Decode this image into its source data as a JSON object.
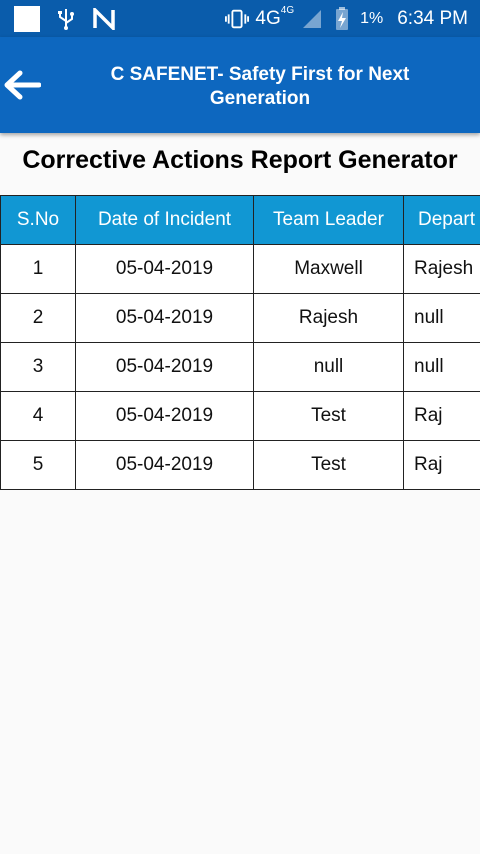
{
  "status_bar": {
    "network": "4G",
    "network_sup": "4G",
    "battery": "1%",
    "time": "6:34 PM"
  },
  "app_bar": {
    "title": "C SAFENET- Safety First for Next\nGeneration"
  },
  "page": {
    "title": "Corrective Actions Report Generator"
  },
  "table": {
    "headers": [
      "S.No",
      "Date of Incident",
      "Team Leader",
      "Depart"
    ],
    "rows": [
      [
        "1",
        "05-04-2019",
        "Maxwell",
        "Rajesh"
      ],
      [
        "2",
        "05-04-2019",
        "Rajesh",
        "null"
      ],
      [
        "3",
        "05-04-2019",
        "null",
        "null"
      ],
      [
        "4",
        "05-04-2019",
        "Test",
        "Raj"
      ],
      [
        "5",
        "05-04-2019",
        "Test",
        "Raj"
      ]
    ]
  }
}
